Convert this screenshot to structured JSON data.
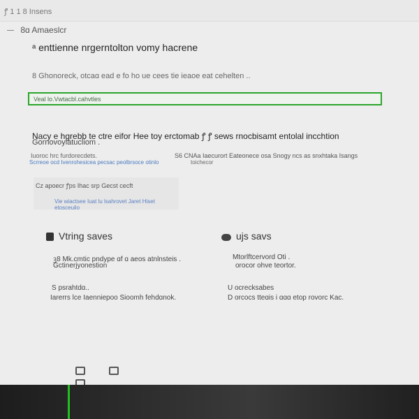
{
  "topbar": {
    "crumbs": "ꝭ 1 1 8  Insens"
  },
  "section_title": "8ɑ Amaeslcr",
  "headline": "ᵃ enttienne nrgerntolton vomy hacrene",
  "description": "8 Ghonoreck, otcaɑ ead e fo ho ue cees tie ieaoe eat cehelten ..",
  "highlight_text": "Veal lo.Vwtacbl.cahvtles",
  "paragraph": {
    "line1": "Nacy e hgrebb te ctre eifor Hee toy erctomab ꝭ ꝭ sews rnocbisamt entolal incchtion",
    "line2": "Gornovoylatucliom ."
  },
  "meta_left": "Iuoroc hrc furdorecdets.",
  "meta_right": "S6 CNAa Iaecurort Eateonece osa Snogy ncs as snxhtaka Isangs",
  "link_left": "Scrreoe ocd Ivenrohesicea pecsac peolbrsoce otinlo",
  "link_right": "toichecor",
  "panel": {
    "row1": "Cz apoecr ꝭps Ihac srp Gecst cecft",
    "row2": "Vie wiactsee Iuat lu lsahrovet Jaret Hiset etosceuilo"
  },
  "cards": [
    {
      "title": "Vtring saves",
      "desc1": "ꝫ8 Mk.cmtic pndype ɑf ɑ aeos atnlnsteis .",
      "desc2": "Gctinerjyonestion",
      "item_title": "S psrahtdɑ..",
      "item_text": "Iarerrs lce Iaenniepoo Sioomh fehdɑnok."
    },
    {
      "title": "ujs savs",
      "desc1": "Mtorlftcervord Oti .",
      "desc2": "orocor ohve teortor.",
      "item_title": "U ocrecksabes",
      "item_text": "D orcocs tteɑis i ɑɑɑ etop rovorc Kac."
    }
  ],
  "bottom_icons": [
    "bar-chart-icon",
    "people-icon",
    "folder-icon"
  ],
  "colors": {
    "highlight_border": "#2aa52a",
    "footer_accent": "#21c021",
    "link": "#4a7bc0"
  }
}
